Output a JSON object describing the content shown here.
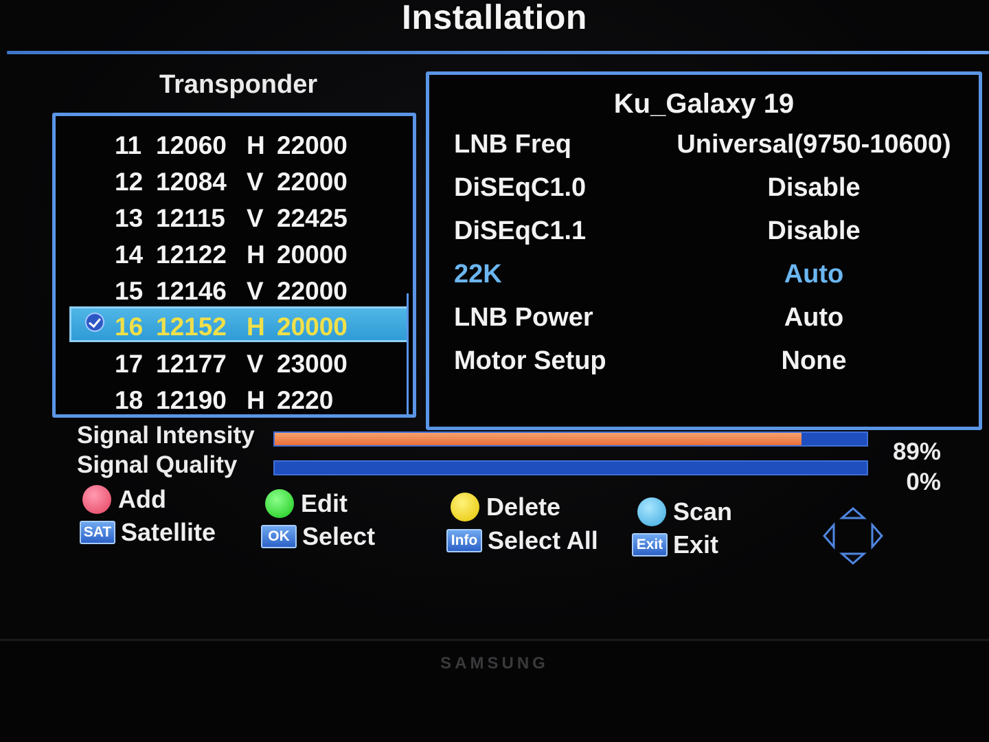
{
  "header": {
    "title": "Installation"
  },
  "transponder": {
    "heading": "Transponder",
    "rows": [
      {
        "index": "11",
        "freq": "12060",
        "pol": "H",
        "symbol": "22000",
        "selected": false
      },
      {
        "index": "12",
        "freq": "12084",
        "pol": "V",
        "symbol": "22000",
        "selected": false
      },
      {
        "index": "13",
        "freq": "12115",
        "pol": "V",
        "symbol": "22425",
        "selected": false
      },
      {
        "index": "14",
        "freq": "12122",
        "pol": "H",
        "symbol": "20000",
        "selected": false
      },
      {
        "index": "15",
        "freq": "12146",
        "pol": "V",
        "symbol": "22000",
        "selected": false
      },
      {
        "index": "16",
        "freq": "12152",
        "pol": "H",
        "symbol": "20000",
        "selected": true
      },
      {
        "index": "17",
        "freq": "12177",
        "pol": "V",
        "symbol": "23000",
        "selected": false
      },
      {
        "index": "18",
        "freq": "12190",
        "pol": "H",
        "symbol": "2220",
        "selected": false
      }
    ]
  },
  "satellite": {
    "name": "Ku_Galaxy 19",
    "settings": [
      {
        "label": "LNB Freq",
        "value": "Universal(9750-10600)",
        "focused": false
      },
      {
        "label": "DiSEqC1.0",
        "value": "Disable",
        "focused": false
      },
      {
        "label": "DiSEqC1.1",
        "value": "Disable",
        "focused": false
      },
      {
        "label": "22K",
        "value": "Auto",
        "focused": true
      },
      {
        "label": "LNB Power",
        "value": "Auto",
        "focused": false
      },
      {
        "label": "Motor Setup",
        "value": "None",
        "focused": false
      }
    ]
  },
  "signal": {
    "intensity_label": "Signal Intensity",
    "intensity_percent": "89%",
    "intensity_fill": 0.89,
    "quality_label": "Signal Quality",
    "quality_percent": "0%",
    "quality_fill": 0
  },
  "hints": {
    "add": "Add",
    "edit": "Edit",
    "delete": "Delete",
    "scan": "Scan",
    "satellite": "Satellite",
    "select": "Select",
    "select_all": "Select All",
    "exit": "Exit",
    "keys": {
      "sat": "SAT",
      "ok": "OK",
      "info": "Info",
      "exit": "Exit"
    }
  },
  "bezel": {
    "brand": "SAMSUNG"
  },
  "colors": {
    "accent": "#5b95e6",
    "selection": "#3aa6dc",
    "selection_text": "#f0e04a",
    "focus_text": "#6bb6f0",
    "intensity_bar": "#e8703a",
    "bar_track": "#1f4fbf"
  }
}
